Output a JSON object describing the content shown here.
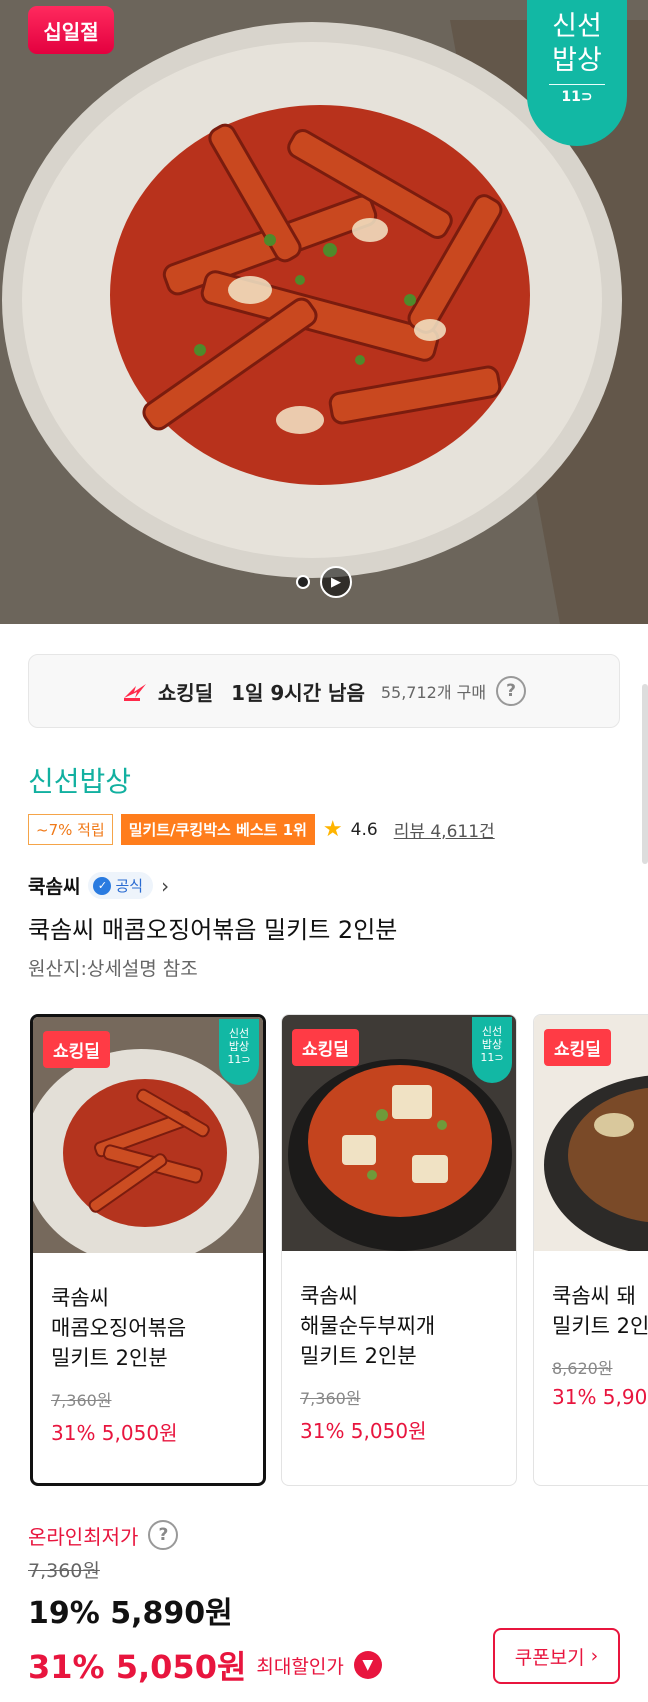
{
  "hero": {
    "badge_11": "십일절",
    "brand_line1": "신선",
    "brand_line2": "밥상",
    "brand_mark": "11⊃"
  },
  "deal": {
    "title": "쇼킹딜",
    "time_left": "1일 9시간 남음",
    "purchases": "55,712개 구매",
    "help": "?"
  },
  "store": {
    "name": "신선밥상"
  },
  "tags": {
    "point": "~7% 적립",
    "best": "밀키트/쿠킹박스 베스트 1위",
    "rating": "4.6",
    "review": "리뷰 4,611건"
  },
  "seller": {
    "name": "쿡솜씨",
    "official": "공식",
    "chevron": "›"
  },
  "product": {
    "title": "쿡솜씨 매콤오징어볶음 밀키트 2인분",
    "origin": "원산지:상세설명 참조"
  },
  "cards": [
    {
      "chip": "쇼킹딜",
      "mini": "신선\n밥상\n11⊃",
      "name_l1": "쿡솜씨",
      "name_l2": "매콤오징어볶음",
      "name_l3": "밀키트 2인분",
      "orig": "7,360원",
      "sale": "31% 5,050원"
    },
    {
      "chip": "쇼킹딜",
      "mini": "신선\n밥상\n11⊃",
      "name_l1": "쿡솜씨",
      "name_l2": "해물순두부찌개",
      "name_l3": "밀키트 2인분",
      "orig": "7,360원",
      "sale": "31% 5,050원"
    },
    {
      "chip": "쇼킹딜",
      "name_l1": "쿡솜씨 돼",
      "name_l2": "밀키트 2인",
      "orig": "8,620원",
      "sale": "31% 5,90"
    }
  ],
  "price": {
    "lowest_label": "온라인최저가",
    "original": "7,360원",
    "discount_price": "19% 5,890원",
    "max_price": "31% 5,050원",
    "max_label": "최대할인가",
    "coupon": "쿠폰보기",
    "coupon_chev": "›"
  },
  "colors": {
    "accent_red": "#e8153e",
    "brand_teal": "#12b8a4",
    "best_orange": "#ff7d1c"
  }
}
